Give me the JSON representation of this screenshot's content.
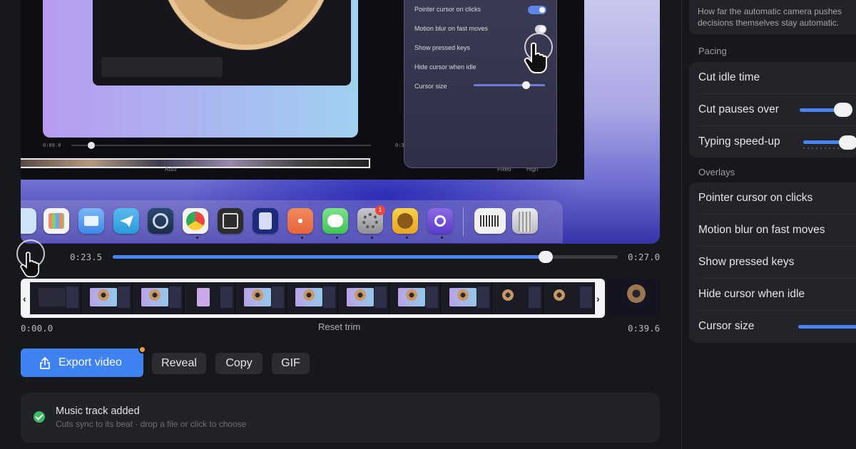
{
  "preview": {
    "panel": {
      "pointer": "Pointer cursor on clicks",
      "motion": "Motion blur on fast moves",
      "keys": "Show pressed keys",
      "hide": "Hide cursor when idle",
      "size": "Cursor size",
      "auto": "Auto",
      "fixed": "Fixed",
      "high": "High"
    },
    "mini_time_start": "0:09.0",
    "mini_time_end": "0:33.9",
    "dock_badge": "1"
  },
  "player": {
    "current_time": "0:23.5",
    "end_time": "0:27.0",
    "progress": 0.857
  },
  "trim": {
    "start": "0:00.0",
    "end": "0:39.6",
    "reset_label": "Reset trim"
  },
  "actions": {
    "export": "Export video",
    "reveal": "Reveal",
    "copy": "Copy",
    "gif": "GIF"
  },
  "music": {
    "title": "Music track added",
    "subtitle": "Cuts sync to its beat · drop a file or click to choose"
  },
  "settings": {
    "description_line1": "How far the automatic camera pushes",
    "description_line2": "decisions themselves stay automatic.",
    "pacing_label": "Pacing",
    "cut_idle": "Cut idle time",
    "cut_pauses": "Cut pauses over",
    "typing": "Typing speed-up",
    "overlays_label": "Overlays",
    "pointer": "Pointer cursor on clicks",
    "motion": "Motion blur on fast moves",
    "keys": "Show pressed keys",
    "hide": "Hide cursor when idle",
    "cursor_size": "Cursor size"
  },
  "colors": {
    "accent": "#3f82f1",
    "success": "#3dbb60",
    "notify": "#f09a3e"
  }
}
